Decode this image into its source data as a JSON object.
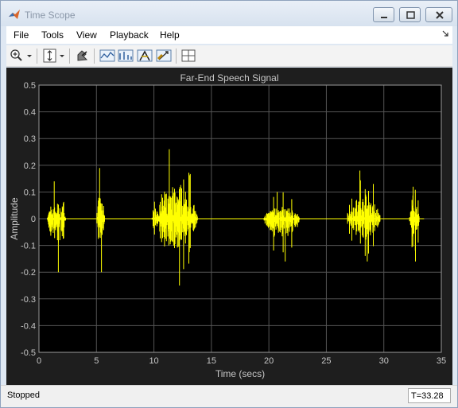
{
  "window": {
    "title": "Time Scope"
  },
  "menu": {
    "items": [
      "File",
      "Tools",
      "View",
      "Playback",
      "Help"
    ]
  },
  "toolbar": {
    "icons": [
      "zoom-in-icon",
      "dropdown-arrow-icon",
      "scale-axes-icon",
      "restore-view-icon",
      "highlight-simulink-icon",
      "data-cursors-icon",
      "signal-statistics-icon",
      "peak-finder-icon",
      "triggers-icon",
      "style-icon",
      "layout-icon"
    ]
  },
  "status": {
    "text": "Stopped",
    "time": "T=33.28"
  },
  "chart_data": {
    "type": "line",
    "title": "Far-End Speech Signal",
    "xlabel": "Time (secs)",
    "ylabel": "Amplitude",
    "xlim": [
      0,
      35
    ],
    "ylim": [
      -0.5,
      0.5
    ],
    "x_ticks": [
      "0",
      "5",
      "10",
      "15",
      "20",
      "25",
      "30",
      "35"
    ],
    "y_ticks": [
      "0.5",
      "0.4",
      "0.3",
      "0.2",
      "0.1",
      "0",
      "-0.1",
      "-0.2",
      "-0.3",
      "-0.4",
      "-0.5"
    ],
    "grid": true,
    "background": "#000000",
    "line_color": "#ffff00",
    "series": [
      {
        "segments": [
          {
            "start": 0.7,
            "end": 2.5,
            "peak": 0.14,
            "trough": -0.2
          },
          {
            "start": 5.0,
            "end": 5.8,
            "peak": 0.19,
            "trough": -0.2
          },
          {
            "start": 9.8,
            "end": 14.2,
            "peak": 0.26,
            "trough": -0.25
          },
          {
            "start": 19.5,
            "end": 23.0,
            "peak": 0.1,
            "trough": -0.16
          },
          {
            "start": 26.8,
            "end": 30.0,
            "peak": 0.18,
            "trough": -0.16
          },
          {
            "start": 32.2,
            "end": 33.2,
            "peak": 0.12,
            "trough": -0.16
          }
        ]
      }
    ]
  }
}
